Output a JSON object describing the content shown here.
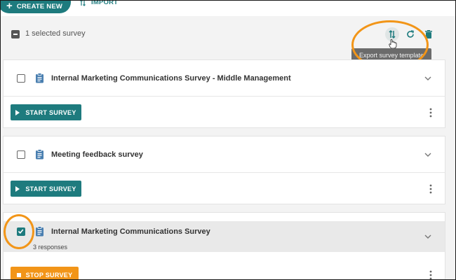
{
  "toolbar": {
    "create_label": "CREATE NEW",
    "import_label": "IMPORT"
  },
  "selection": {
    "text": "1 selected survey",
    "tooltip": "Export survey template"
  },
  "surveys": [
    {
      "title": "Internal Marketing Communications Survey - Middle Management",
      "checked": false,
      "action_label": "START SURVEY"
    },
    {
      "title": "Meeting feedback survey",
      "checked": false,
      "action_label": "START SURVEY"
    },
    {
      "title": "Internal Marketing Communications Survey",
      "checked": true,
      "responses": "3 responses",
      "action_label": "STOP SURVEY"
    }
  ],
  "colors": {
    "accent": "#1e7b7e",
    "warning": "#f29518",
    "highlight": "#f29518"
  }
}
